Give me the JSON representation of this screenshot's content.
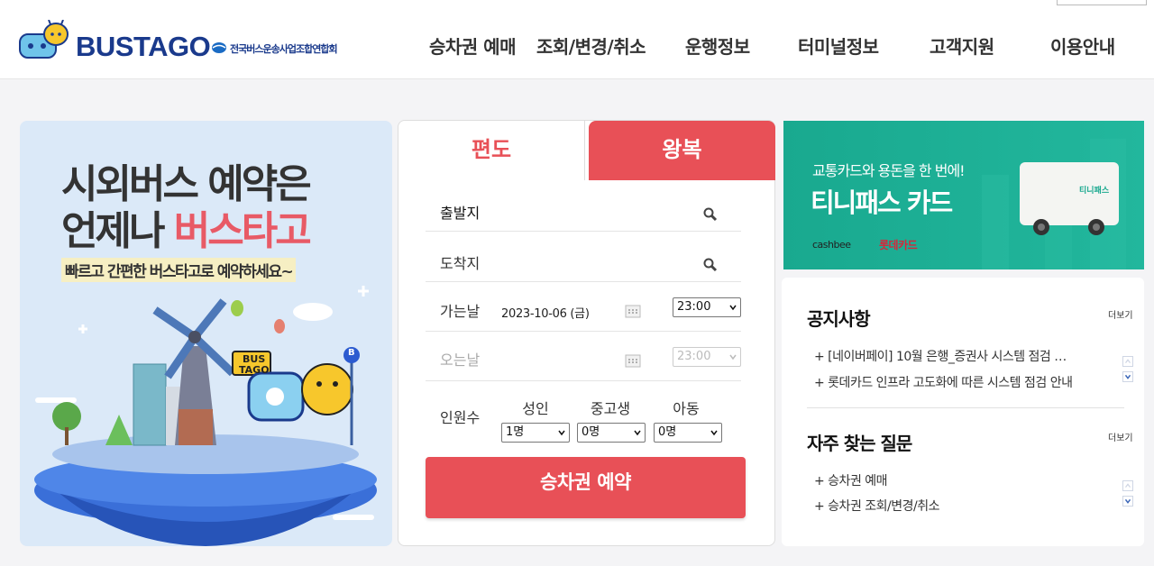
{
  "header": {
    "logo_text": "BUSTAGO",
    "association_text": "전국버스운송사업조합연합회",
    "nav": [
      {
        "label": "승차권 예매"
      },
      {
        "label": "조회/변경/취소"
      },
      {
        "label": "운행정보"
      },
      {
        "label": "터미널정보"
      },
      {
        "label": "고객지원"
      },
      {
        "label": "이용안내"
      }
    ]
  },
  "banner": {
    "line1": "시외버스 예약은",
    "line2_prefix": "언제나 ",
    "line2_highlight": "버스타고",
    "subtitle": "빠르고 간편한 버스타고로 예약하세요~",
    "sign_line1": "BUS",
    "sign_line2": "TAGO",
    "stop_sign": "B"
  },
  "booking": {
    "tabs": {
      "oneway": "편도",
      "roundtrip": "왕복"
    },
    "departure_label": "출발지",
    "arrival_label": "도착지",
    "go_date_label": "가는날",
    "go_date_value": "2023-10-06 (금)",
    "go_time": "23:00",
    "return_date_label": "오는날",
    "return_time": "23:00",
    "pax_label": "인원수",
    "pax": {
      "adult_label": "성인",
      "adult_value": "1명",
      "youth_label": "중고생",
      "youth_value": "0명",
      "child_label": "아동",
      "child_value": "0명"
    },
    "reserve_button": "승차권 예약"
  },
  "ad": {
    "subtitle": "교통카드와 용돈을 한 번에!",
    "title": "티니패스 카드",
    "brand1": "cashbee",
    "brand2": "롯데카드",
    "card_text": "티니패스"
  },
  "notice": {
    "title": "공지사항",
    "more": "더보기",
    "items": [
      "+ [네이버페이] 10월 은행_증권사 시스템 점검 …",
      "+ 롯데카드 인프라 고도화에 따른 시스템 점검 안내"
    ]
  },
  "faq": {
    "title": "자주 찾는 질문",
    "more": "더보기",
    "items": [
      "+ 승차권 예매",
      "+ 승차권 조회/변경/취소"
    ]
  },
  "colors": {
    "brand_red": "#e85057",
    "brand_blue": "#1a3a8c",
    "ad_green": "#19a98f"
  }
}
